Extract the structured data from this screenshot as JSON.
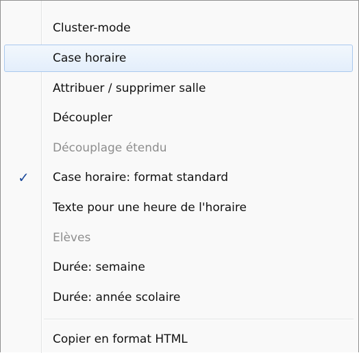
{
  "menu": {
    "items": [
      {
        "label": "Cluster-mode",
        "disabled": false,
        "checked": false,
        "highlighted": false
      },
      {
        "label": "Case horaire",
        "disabled": false,
        "checked": false,
        "highlighted": true
      },
      {
        "label": "Attribuer / supprimer salle",
        "disabled": false,
        "checked": false,
        "highlighted": false
      },
      {
        "label": "Découpler",
        "disabled": false,
        "checked": false,
        "highlighted": false
      },
      {
        "label": "Découplage étendu",
        "disabled": true,
        "checked": false,
        "highlighted": false
      },
      {
        "label": "Case horaire: format standard",
        "disabled": false,
        "checked": true,
        "highlighted": false
      },
      {
        "label": "Texte pour une heure de l'horaire",
        "disabled": false,
        "checked": false,
        "highlighted": false
      },
      {
        "label": "Elèves",
        "disabled": true,
        "checked": false,
        "highlighted": false
      },
      {
        "label": "Durée: semaine",
        "disabled": false,
        "checked": false,
        "highlighted": false
      },
      {
        "label": "Durée: année scolaire",
        "disabled": false,
        "checked": false,
        "highlighted": false
      },
      {
        "label": "Copier en format HTML",
        "disabled": false,
        "checked": false,
        "highlighted": false
      }
    ],
    "check_glyph": "✓",
    "colors": {
      "highlight_border": "#a8c8ee",
      "disabled_text": "#8d8d8d",
      "check_color": "#1c4a9b"
    }
  }
}
